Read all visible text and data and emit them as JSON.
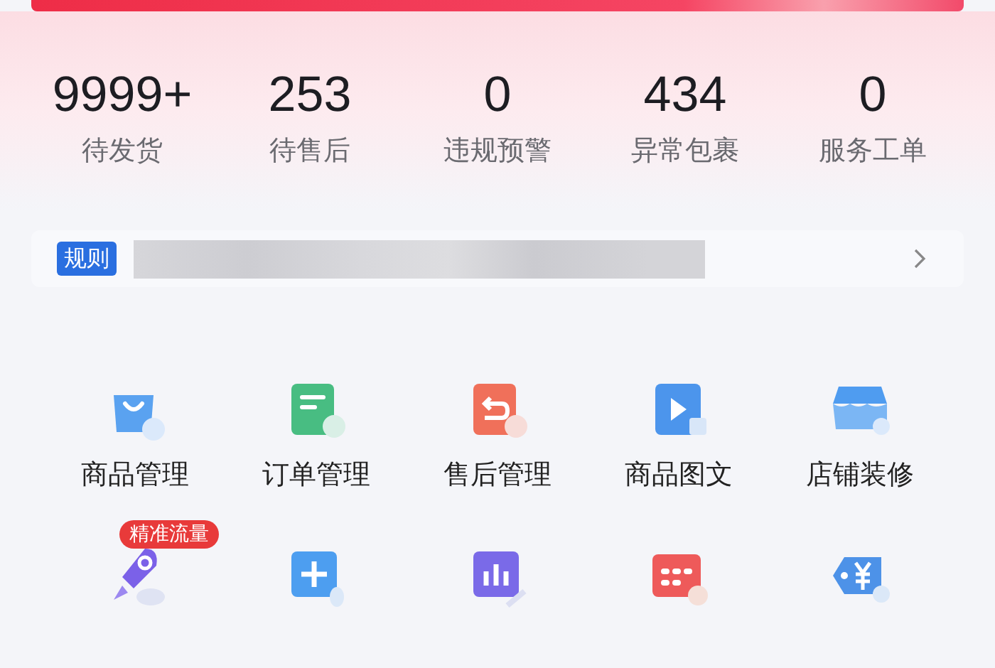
{
  "stats": [
    {
      "value": "9999+",
      "label": "待发货"
    },
    {
      "value": "253",
      "label": "待售后"
    },
    {
      "value": "0",
      "label": "违规预警"
    },
    {
      "value": "434",
      "label": "异常包裹"
    },
    {
      "value": "0",
      "label": "服务工单"
    }
  ],
  "notice": {
    "tag": "规则"
  },
  "tools": [
    {
      "kind": "bag",
      "label": "商品管理"
    },
    {
      "kind": "document",
      "label": "订单管理"
    },
    {
      "kind": "return",
      "label": "售后管理"
    },
    {
      "kind": "video",
      "label": "商品图文"
    },
    {
      "kind": "store",
      "label": "店铺装修"
    },
    {
      "kind": "rocket",
      "badge": "精准流量"
    },
    {
      "kind": "plus"
    },
    {
      "kind": "chart"
    },
    {
      "kind": "calendar"
    },
    {
      "kind": "tag"
    }
  ]
}
